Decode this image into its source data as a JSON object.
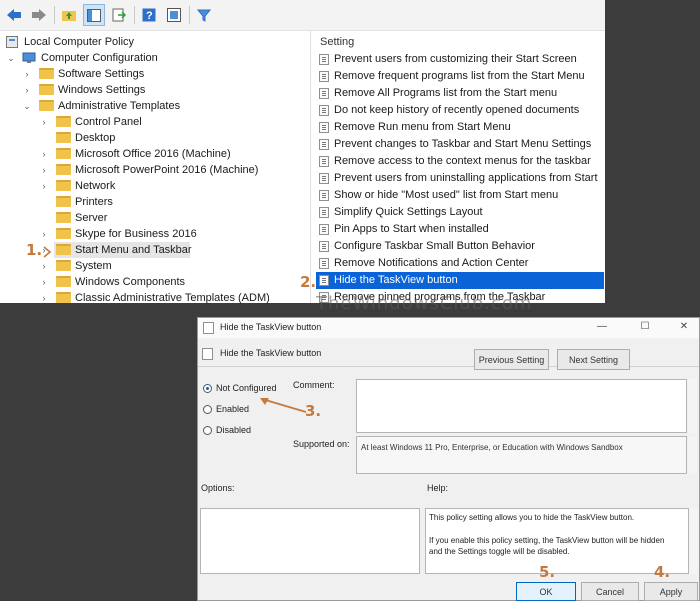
{
  "tree": {
    "items": [
      {
        "label": "Local Computer Policy"
      },
      {
        "label": "Computer Configuration"
      },
      {
        "label": "Software Settings"
      },
      {
        "label": "Windows Settings"
      },
      {
        "label": "Administrative Templates"
      },
      {
        "label": "Control Panel"
      },
      {
        "label": "Desktop"
      },
      {
        "label": "Microsoft Office 2016 (Machine)"
      },
      {
        "label": "Microsoft PowerPoint 2016 (Machine)"
      },
      {
        "label": "Network"
      },
      {
        "label": "Printers"
      },
      {
        "label": "Server"
      },
      {
        "label": "Skype for Business 2016"
      },
      {
        "label": "Start Menu and Taskbar"
      },
      {
        "label": "System"
      },
      {
        "label": "Windows Components"
      },
      {
        "label": "Classic Administrative Templates (ADM)"
      }
    ]
  },
  "list": {
    "header": "Setting",
    "items": [
      "Prevent users from customizing their Start Screen",
      "Remove frequent programs list from the Start Menu",
      "Remove All Programs list from the Start menu",
      "Do not keep history of recently opened documents",
      "Remove Run menu from Start Menu",
      "Prevent changes to Taskbar and Start Menu Settings",
      "Remove access to the context menus for the taskbar",
      "Prevent users from uninstalling applications from Start",
      "Show or hide \"Most used\" list from Start menu",
      "Simplify Quick Settings Layout",
      "Pin Apps to Start when installed",
      "Configure Taskbar Small Button Behavior",
      "Remove Notifications and Action Center",
      "Hide the TaskView button",
      "Remove pinned programs from the Taskbar"
    ]
  },
  "steps": {
    "s1": "1.",
    "s2": "2.",
    "s3": "3.",
    "s4": "4.",
    "s5": "5."
  },
  "watermark": "TheWindowsClub.com",
  "dialog": {
    "title": "Hide the TaskView button",
    "setting_name": "Hide the TaskView button",
    "prev_label": "Previous Setting",
    "next_label": "Next Setting",
    "not_configured": "Not Configured",
    "enabled": "Enabled",
    "disabled": "Disabled",
    "comment_label": "Comment:",
    "supported_label": "Supported on:",
    "supported_value": "At least Windows 11 Pro, Enterprise, or Education with Windows Sandbox",
    "options_label": "Options:",
    "help_label": "Help:",
    "help_p1": "This policy setting allows you to hide the TaskView button.",
    "help_p2": "If you enable this policy setting, the TaskView button will be hidden and the Settings toggle will be disabled.",
    "ok": "OK",
    "cancel": "Cancel",
    "apply": "Apply",
    "minimize": "—",
    "maximize": "☐",
    "close": "✕"
  }
}
